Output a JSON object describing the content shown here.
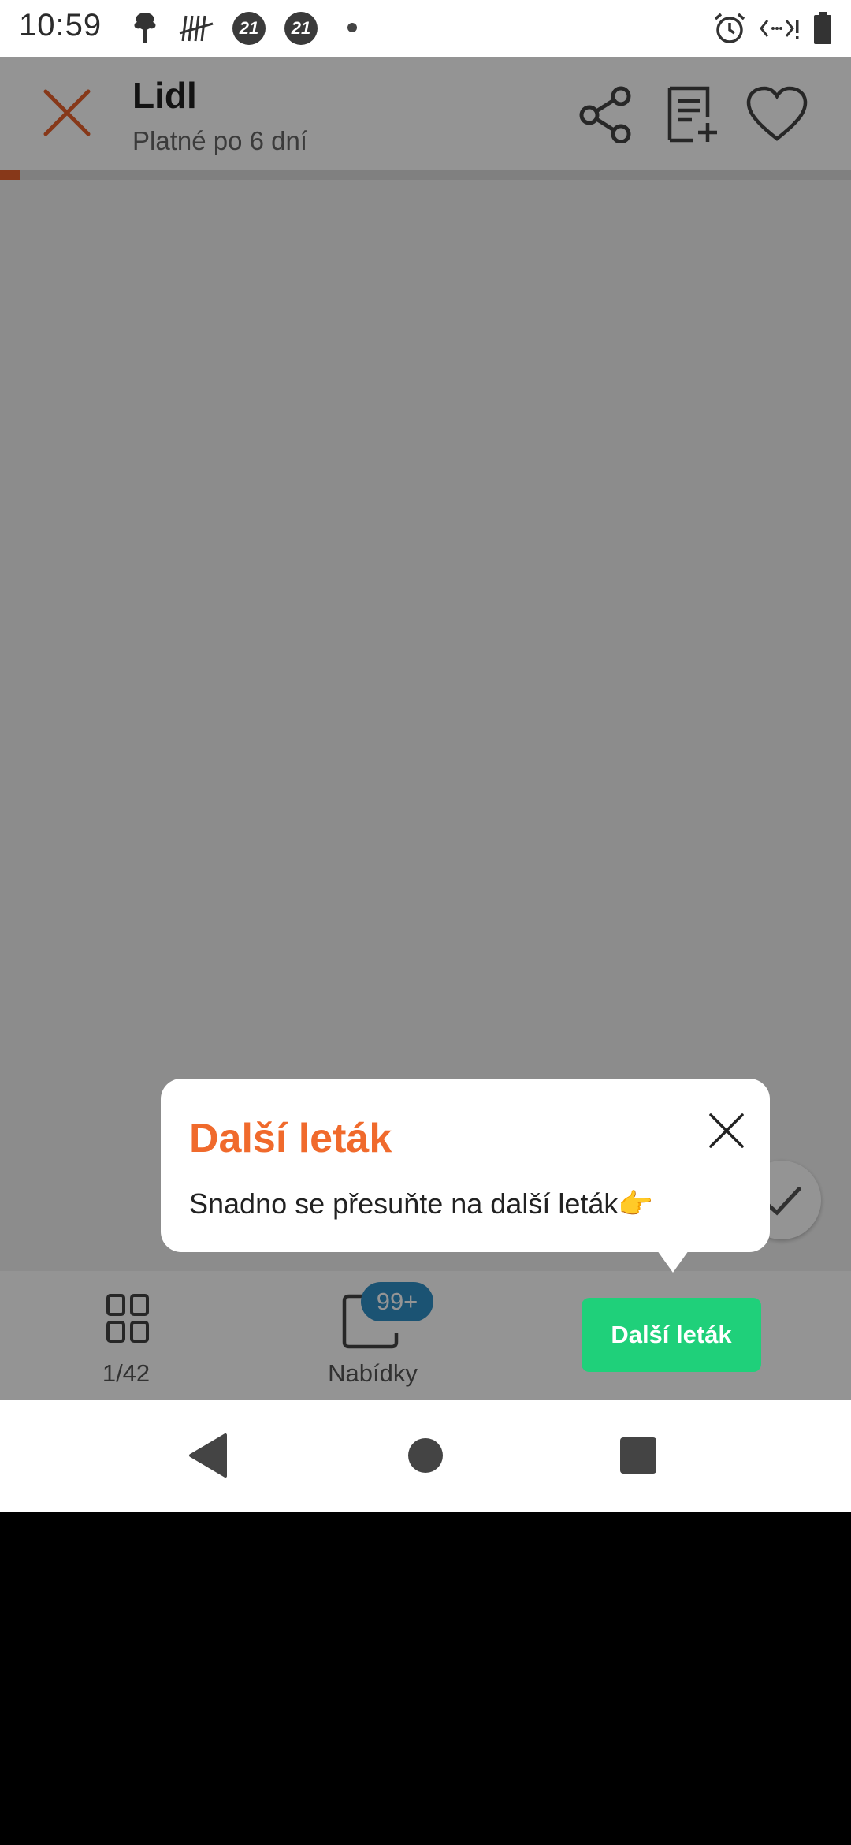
{
  "status_bar": {
    "time": "10:59",
    "badge_1": "21",
    "badge_2": "21",
    "icons": [
      "tree-icon",
      "tally-icon",
      "badge-21-icon",
      "badge-21-icon",
      "dot-icon",
      "alarm-icon",
      "data-icon",
      "battery-icon"
    ]
  },
  "header": {
    "title": "Lidl",
    "subtitle": "Platné po 6 dní",
    "icons": [
      "close-icon",
      "share-icon",
      "add-to-list-icon",
      "heart-icon"
    ]
  },
  "progress": {
    "current_page": 1,
    "total_pages": 42
  },
  "bottom_bar": {
    "pages_label": "1/42",
    "offers_label": "Nabídky",
    "offers_badge": "99+",
    "next_button_label": "Další leták"
  },
  "tooltip": {
    "title": "Další leták",
    "text": "Snadno se přesuňte na další leták👉"
  },
  "colors": {
    "accent_orange": "#f06a2c",
    "green_button": "#1fd07a",
    "badge_blue": "#2f8fc7"
  }
}
